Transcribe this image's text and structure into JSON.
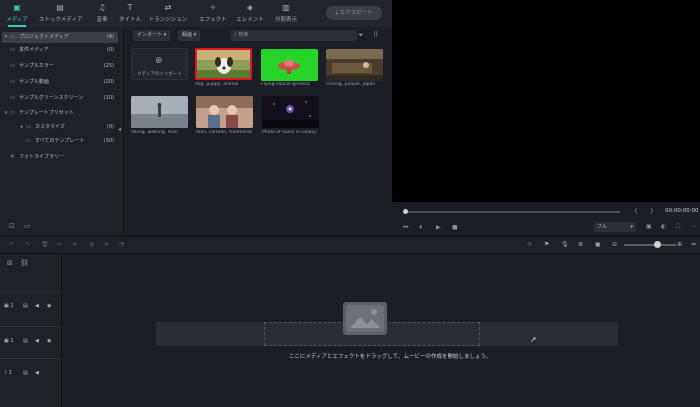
{
  "top_tabs": [
    {
      "label": "メディア",
      "icon": "media-icon",
      "glyph": "▣",
      "active": true
    },
    {
      "label": "ストックメディア",
      "icon": "stock-media-icon",
      "glyph": "▤",
      "active": false
    },
    {
      "label": "音楽",
      "icon": "music-icon",
      "glyph": "♫",
      "active": false
    },
    {
      "label": "タイトル",
      "icon": "title-icon",
      "glyph": "T",
      "active": false
    },
    {
      "label": "トランジション",
      "icon": "transition-icon",
      "glyph": "⇄",
      "active": false
    },
    {
      "label": "エフェクト",
      "icon": "effect-icon",
      "glyph": "✧",
      "active": false
    },
    {
      "label": "エレメント",
      "icon": "element-icon",
      "glyph": "◈",
      "active": false
    },
    {
      "label": "分割表示",
      "icon": "split-screen-icon",
      "glyph": "▥",
      "active": false
    }
  ],
  "export_button": "エクスポート",
  "sidebar": {
    "items": [
      {
        "label": "プロジェクトメディア",
        "count": "(4)",
        "arrow": "▾",
        "active": true
      },
      {
        "label": "本件メディア",
        "count": "(0)",
        "arrow": "",
        "active": false
      },
      {
        "label": "サンプルカラー",
        "count": "(25)",
        "arrow": "",
        "active": false
      },
      {
        "label": "サンプル動画",
        "count": "(20)",
        "arrow": "",
        "active": false
      },
      {
        "label": "サンプルグリーンスクリーン",
        "count": "(10)",
        "arrow": "",
        "active": false
      },
      {
        "label": "テンプレートプリセット",
        "count": "",
        "arrow": "▾",
        "active": false
      },
      {
        "label": "カスタマイズ",
        "count": "(0)",
        "arrow": "▸",
        "active": false
      },
      {
        "label": "すべてのテンプレート",
        "count": "(30)",
        "arrow": "",
        "active": false
      },
      {
        "label": "フォトライブラリー",
        "count": "",
        "arrow": "",
        "active": false
      }
    ]
  },
  "media_toolbar": {
    "import_label": "インポート",
    "record_label": "録画",
    "search_placeholder": "検索"
  },
  "media_items": [
    {
      "caption": "メディアのインポート",
      "kind": "import"
    },
    {
      "caption": "dog, puppy, animal",
      "kind": "dog"
    },
    {
      "caption": "Flying-saucer-greensc",
      "kind": "ufo"
    },
    {
      "caption": "Fishing, people, Japan",
      "kind": "fishing"
    },
    {
      "caption": "hiking, walking, man",
      "kind": "hiking"
    },
    {
      "caption": "man, cartoon, traditional",
      "kind": "cartoon"
    },
    {
      "caption": "Photo of Ruins in Galaxy",
      "kind": "galaxy"
    }
  ],
  "preview": {
    "timecode": "00:00:00:00",
    "quality_label": "フル"
  },
  "tracks": [
    {
      "label": "▣ 2"
    },
    {
      "label": "▣ 1"
    },
    {
      "label": "♪ 1"
    }
  ],
  "timeline": {
    "drop_hint": "ここにメディアとエフェクトをドラッグして、ムービーの作成を開始しましょう。"
  },
  "colors": {
    "accent": "#2fd0c0",
    "selection": "#e0191f",
    "green_screen": "#27d52a"
  }
}
